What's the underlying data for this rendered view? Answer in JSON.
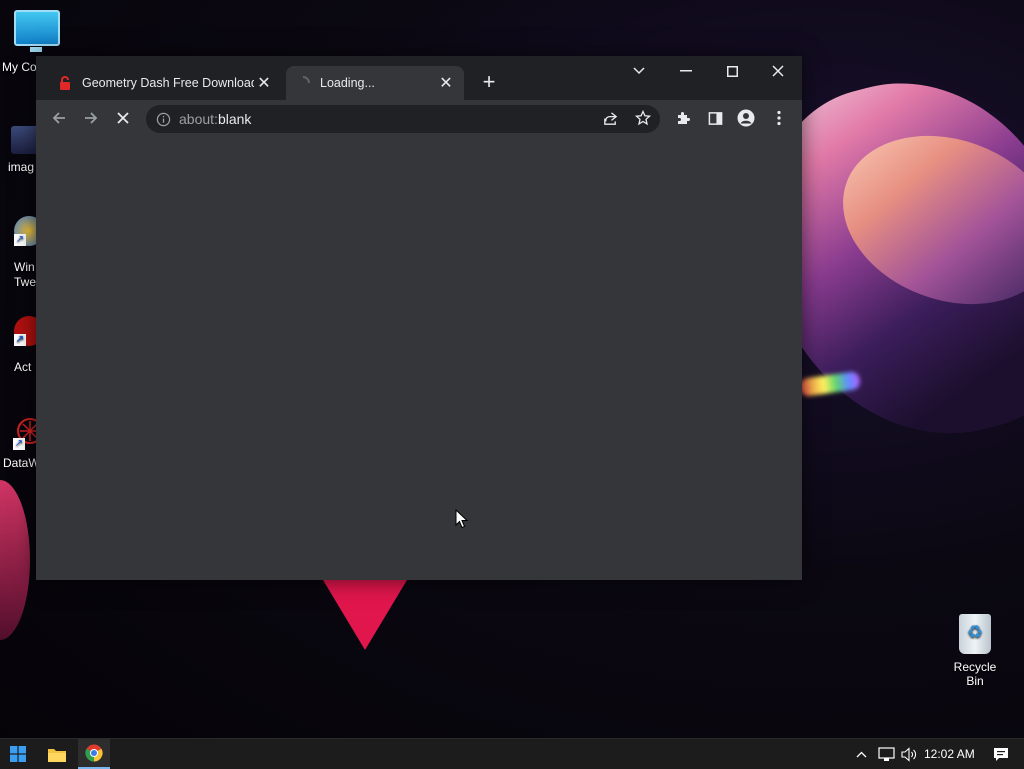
{
  "desktop": {
    "icons": [
      {
        "label": "My Co",
        "name": "my-computer"
      },
      {
        "label": "imag",
        "name": "images"
      },
      {
        "label": "Win\nTwe",
        "name": "win-tweaker"
      },
      {
        "label": "Act",
        "name": "act"
      },
      {
        "label": "DataW",
        "name": "dataw"
      }
    ],
    "recycle_bin": "Recycle Bin"
  },
  "browser": {
    "tabs": [
      {
        "title": "Geometry Dash Free Download (",
        "favicon": "red-lock-icon"
      },
      {
        "title": "Loading...",
        "favicon": "loading-spinner-icon"
      }
    ],
    "address": {
      "scheme": "about:",
      "host": "blank"
    },
    "colors": {
      "frame": "#202124",
      "toolbar": "#35363a",
      "omnibox": "#202124"
    }
  },
  "taskbar": {
    "clock": "12:02 AM"
  }
}
